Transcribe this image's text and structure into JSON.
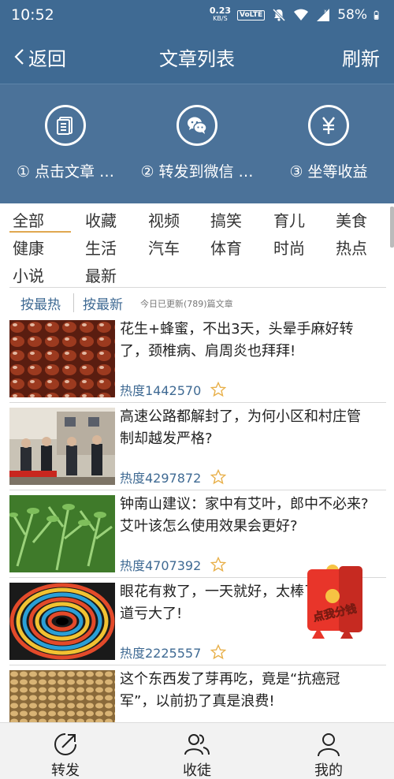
{
  "status_bar": {
    "time": "10:52",
    "speed_value": "0.23",
    "speed_unit": "KB/S",
    "volte": "VoLTE",
    "battery": "58%"
  },
  "header": {
    "back_label": "返回",
    "title": "文章列表",
    "refresh_label": "刷新"
  },
  "steps": [
    {
      "label": "① 点击文章 …",
      "icon": "article-icon"
    },
    {
      "label": "② 转发到微信 …",
      "icon": "wechat-icon"
    },
    {
      "label": "③ 坐等收益",
      "icon": "yen-icon"
    }
  ],
  "categories": [
    "全部",
    "收藏",
    "视频",
    "搞笑",
    "育儿",
    "美食",
    "健康",
    "生活",
    "汽车",
    "体育",
    "时尚",
    "热点",
    "小说",
    "最新"
  ],
  "active_category": "全部",
  "sort": {
    "hot_label": "按最热",
    "latest_label": "按最新",
    "today_note": "今日已更新(789)篇文章"
  },
  "articles": [
    {
      "title": "花生+蜂蜜，不出3天，头晕手麻好转了，颈椎病、肩周炎也拜拜!",
      "heat": "热度1442570",
      "thumb": "peanuts"
    },
    {
      "title": "高速公路都解封了，为何小区和村庄管制却越发严格?",
      "heat": "热度4297872",
      "thumb": "checkpoint"
    },
    {
      "title": "钟南山建议：家中有艾叶，郎中不必来? 艾叶该怎么使用效果会更好?",
      "heat": "热度4707392",
      "thumb": "mugwort"
    },
    {
      "title": "眼花有救了，一天就好，太棒了，不知道亏大了!",
      "heat": "热度2225557",
      "thumb": "spiral"
    },
    {
      "title": "这个东西发了芽再吃，竟是“抗癌冠军”，以前扔了真是浪费!",
      "heat": "",
      "thumb": "grains"
    }
  ],
  "promo": {
    "label": "点我分钱"
  },
  "bottom_nav": [
    {
      "label": "转发",
      "icon": "share-icon"
    },
    {
      "label": "收徒",
      "icon": "recruit-icon"
    },
    {
      "label": "我的",
      "icon": "profile-icon"
    }
  ],
  "colors": {
    "header_bg": "#3f6a93",
    "banner_bg": "#4b7299",
    "accent_underline": "#e0a850",
    "link_blue": "#3f6a93"
  }
}
